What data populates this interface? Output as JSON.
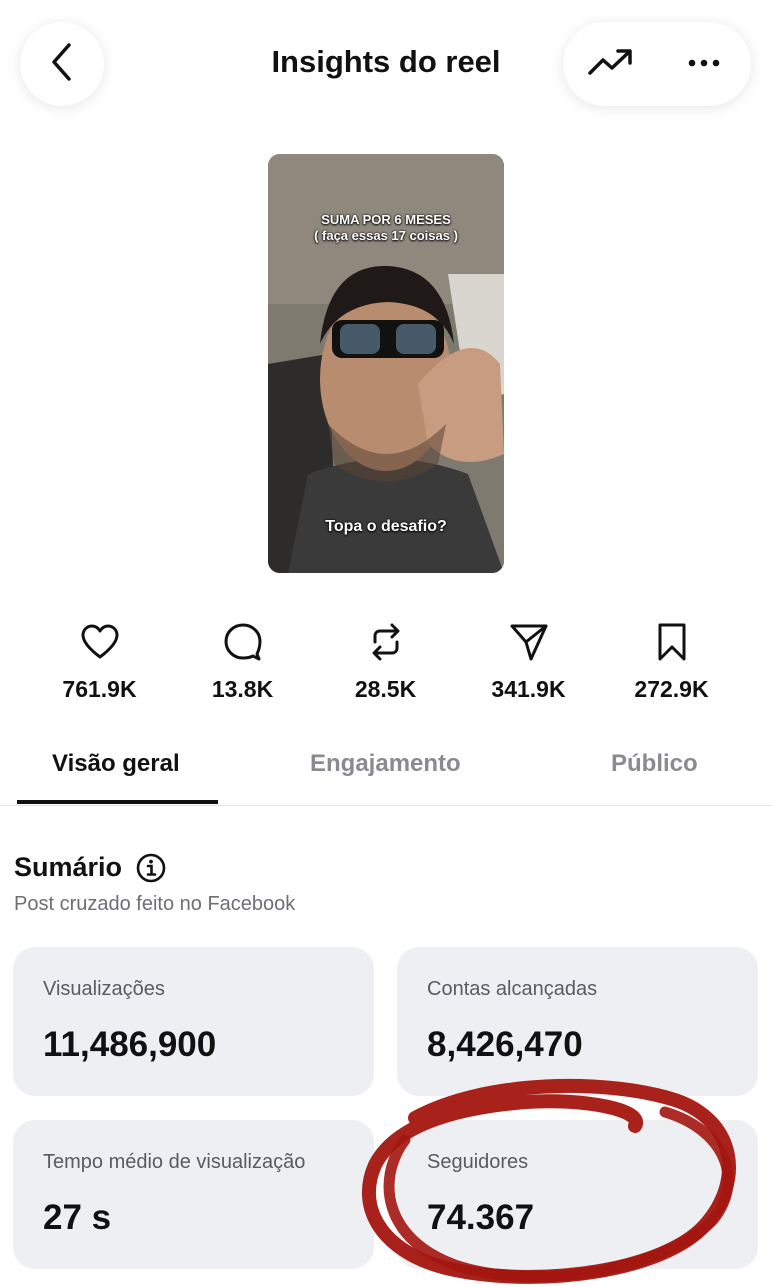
{
  "header": {
    "title": "Insights do reel",
    "back_icon": "chevron-left-icon",
    "trend_icon": "trending-up-icon",
    "more_icon": "more-horizontal-icon"
  },
  "reel": {
    "caption_top_line1": "SUMA POR 6 MESES",
    "caption_top_line2": "( faça essas 17 coisas )",
    "caption_bottom": "Topa o desafio?"
  },
  "stats": [
    {
      "icon": "heart-icon",
      "value": "761.9K"
    },
    {
      "icon": "comment-icon",
      "value": "13.8K"
    },
    {
      "icon": "repost-icon",
      "value": "28.5K"
    },
    {
      "icon": "send-icon",
      "value": "341.9K"
    },
    {
      "icon": "bookmark-icon",
      "value": "272.9K"
    }
  ],
  "tabs": [
    {
      "label": "Visão geral",
      "active": true
    },
    {
      "label": "Engajamento",
      "active": false
    },
    {
      "label": "Público",
      "active": false
    }
  ],
  "summary": {
    "title": "Sumário",
    "subtitle": "Post cruzado feito no Facebook",
    "cards": [
      {
        "label": "Visualizações",
        "value": "11,486,900"
      },
      {
        "label": "Contas alcançadas",
        "value": "8,426,470"
      },
      {
        "label": "Tempo médio de visualização",
        "value": "27 s"
      },
      {
        "label": "Seguidores",
        "value": "74.367"
      }
    ]
  },
  "colors": {
    "annotation": "#a3160f",
    "card_bg": "#eeeff3",
    "muted_text": "#6e6e74"
  }
}
